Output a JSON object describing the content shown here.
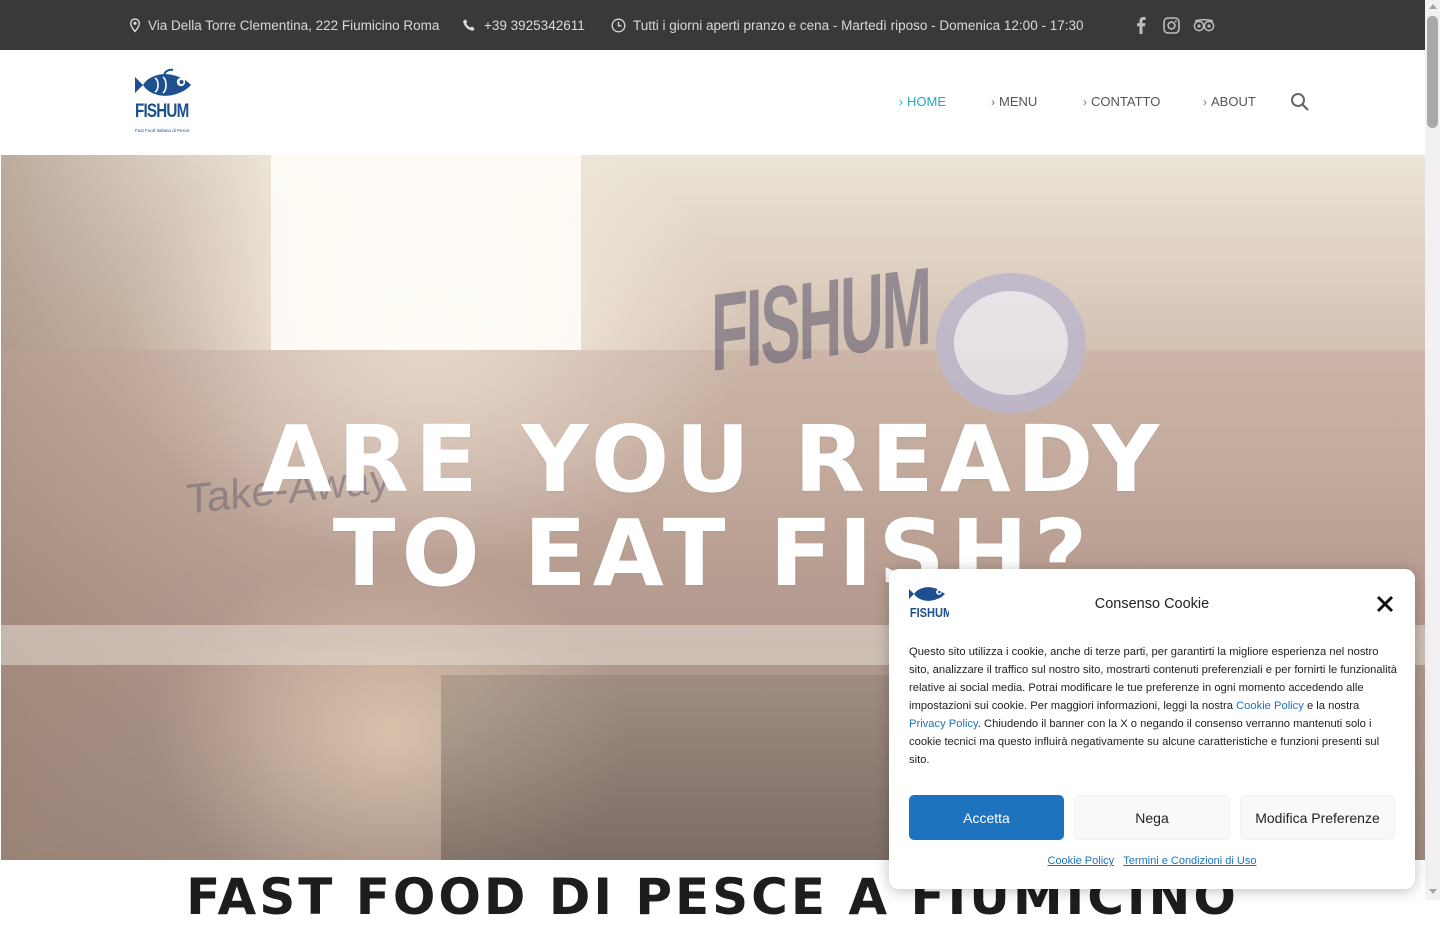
{
  "topbar": {
    "address": "Via Della Torre Clementina, 222 Fiumicino Roma",
    "phone": "+39 3925342611",
    "hours": "Tutti i giorni aperti pranzo e cena - Martedì riposo - Domenica 12:00 - 17:30",
    "social": [
      "facebook-icon",
      "instagram-icon",
      "tripadvisor-icon"
    ]
  },
  "header": {
    "logo_text": "FISHUM",
    "logo_tagline": "Fast Food Italiano di Pesce",
    "nav": [
      {
        "label": "HOME",
        "active": true
      },
      {
        "label": "MENU",
        "active": false
      },
      {
        "label": "CONTATTO",
        "active": false
      },
      {
        "label": "ABOUT",
        "active": false
      }
    ]
  },
  "hero": {
    "title_line1": "ARE YOU READY",
    "title_line2": "TO EAT FISH?",
    "sign_text": "FISHUM",
    "takeaway_text": "Take-Away"
  },
  "section": {
    "heading": "FAST FOOD DI PESCE A FIUMICINO"
  },
  "cookie": {
    "title": "Consenso Cookie",
    "text_part1": "Questo sito utilizza i cookie, anche di terze parti, per garantirti la migliore esperienza nel nostro sito, analizzare il traffico sul nostro sito, mostrarti contenuti preferenziali e per fornirti le funzionalità relative ai social media. Potrai modificare le tue preferenze in ogni momento accedendo alle impostazioni sui cookie. Per maggiori informazioni, leggi la nostra ",
    "link_cookie_policy": "Cookie Policy",
    "text_part2": " e la nostra ",
    "link_privacy_policy": "Privacy Policy",
    "text_part3": ". Chiudendo il banner con la X o negando il consenso verranno mantenuti solo i cookie tecnici ma questo influirà negativamente su alcune caratteristiche e funzioni presenti sul sito.",
    "accept_label": "Accetta",
    "deny_label": "Nega",
    "prefs_label": "Modifica Preferenze",
    "footer_link1": "Cookie Policy",
    "footer_link2": "Termini e Condizioni di Uso"
  },
  "colors": {
    "topbar_bg": "#3a3838",
    "accent": "#21a9c3",
    "brand_blue": "#1e4f8e",
    "button_blue": "#1e73be"
  }
}
